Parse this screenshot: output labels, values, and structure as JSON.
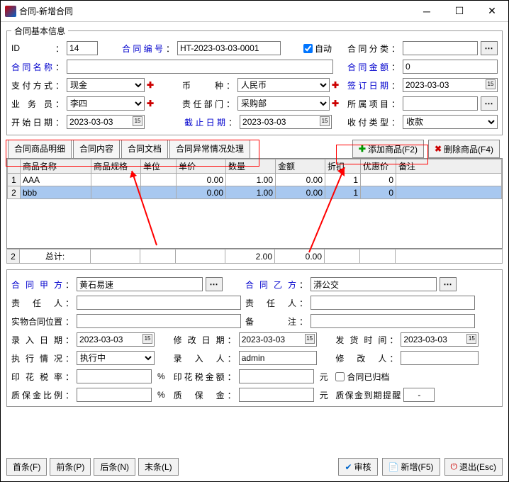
{
  "window": {
    "title": "合同-新增合同"
  },
  "top": {
    "legend": "合同基本信息",
    "id_label": "ID",
    "id_value": "14",
    "bh_label": "合同编号",
    "bh_value": "HT-2023-03-03-0001",
    "auto_label": "自动",
    "fl_label": "合同分类",
    "mc_label": "合同名称",
    "je_label": "合同金额",
    "je_value": "0",
    "zf_label": "支付方式",
    "zf_value": "现金",
    "bz_label": "币　　种",
    "bz_value": "人民币",
    "qyrq_label": "签订日期",
    "qyrq_value": "2023-03-03",
    "ywy_label": "业 务 员",
    "ywy_value": "李四",
    "bm_label": "责任部门",
    "bm_value": "采购部",
    "xm_label": "所属项目",
    "ks_label": "开始日期",
    "ks_value": "2023-03-03",
    "jz_label": "截止日期",
    "jz_value": "2023-03-03",
    "sflx_label": "收付类型",
    "sflx_value": "收款"
  },
  "tabs": [
    "合同商品明细",
    "合同内容",
    "合同文档",
    "合同异常情况处理"
  ],
  "g_btn": {
    "add": "添加商品(F2)",
    "del": "删除商品(F4)"
  },
  "grid": {
    "cols": [
      "商品名称",
      "商品规格",
      "单位",
      "单价",
      "数量",
      "金额",
      "折扣",
      "优惠价",
      "备注"
    ],
    "rows": [
      {
        "no": "1",
        "name": "AAA",
        "spec": "",
        "unit": "",
        "price": "0.00",
        "qty": "1.00",
        "amt": "0.00",
        "disc": "1",
        "yh": "0",
        "rem": ""
      },
      {
        "no": "2",
        "name": "bbb",
        "spec": "",
        "unit": "",
        "price": "0.00",
        "qty": "1.00",
        "amt": "0.00",
        "disc": "1",
        "yh": "0",
        "rem": ""
      }
    ],
    "totals": {
      "no": "2",
      "label": "总计:",
      "qty": "2.00",
      "amt": "0.00"
    }
  },
  "b": {
    "jf_label": "合同甲方",
    "jf_value": "黄石易速",
    "yf_label": "合同乙方",
    "yf_value": "漭公交",
    "zr1_label": "责 任 人",
    "zr2_label": "责 任 人",
    "swwz_label": "实物合同位置",
    "bzhu_label": "备　　注",
    "lrrq_label": "录入日期",
    "lrrq_value": "2023-03-03",
    "xgrq_label": "修改日期",
    "xgrq_value": "2023-03-03",
    "fhsj_label": "发货时间",
    "fhsj_value": "2023-03-03",
    "zxqk_label": "执行情况",
    "zxqk_value": "执行中",
    "lrr_label": "录 入 人",
    "lrr_value": "admin",
    "xgr_label": "修 改 人",
    "yhsl_label": "印花税率",
    "pct": "%",
    "yhsje_label": "印花税金额",
    "yuan": "元",
    "gd_label": "合同已归档",
    "zbjbl_label": "质保金比例",
    "zbj_label": "质 保 金",
    "zbjtx_label": "质保金到期提醒",
    "zbjtx_value": "-"
  },
  "footer": {
    "first": "首条(F)",
    "prev": "前条(P)",
    "next": "后条(N)",
    "last": "末条(L)",
    "audit": "审核",
    "new": "新增(F5)",
    "exit": "退出(Esc)"
  }
}
